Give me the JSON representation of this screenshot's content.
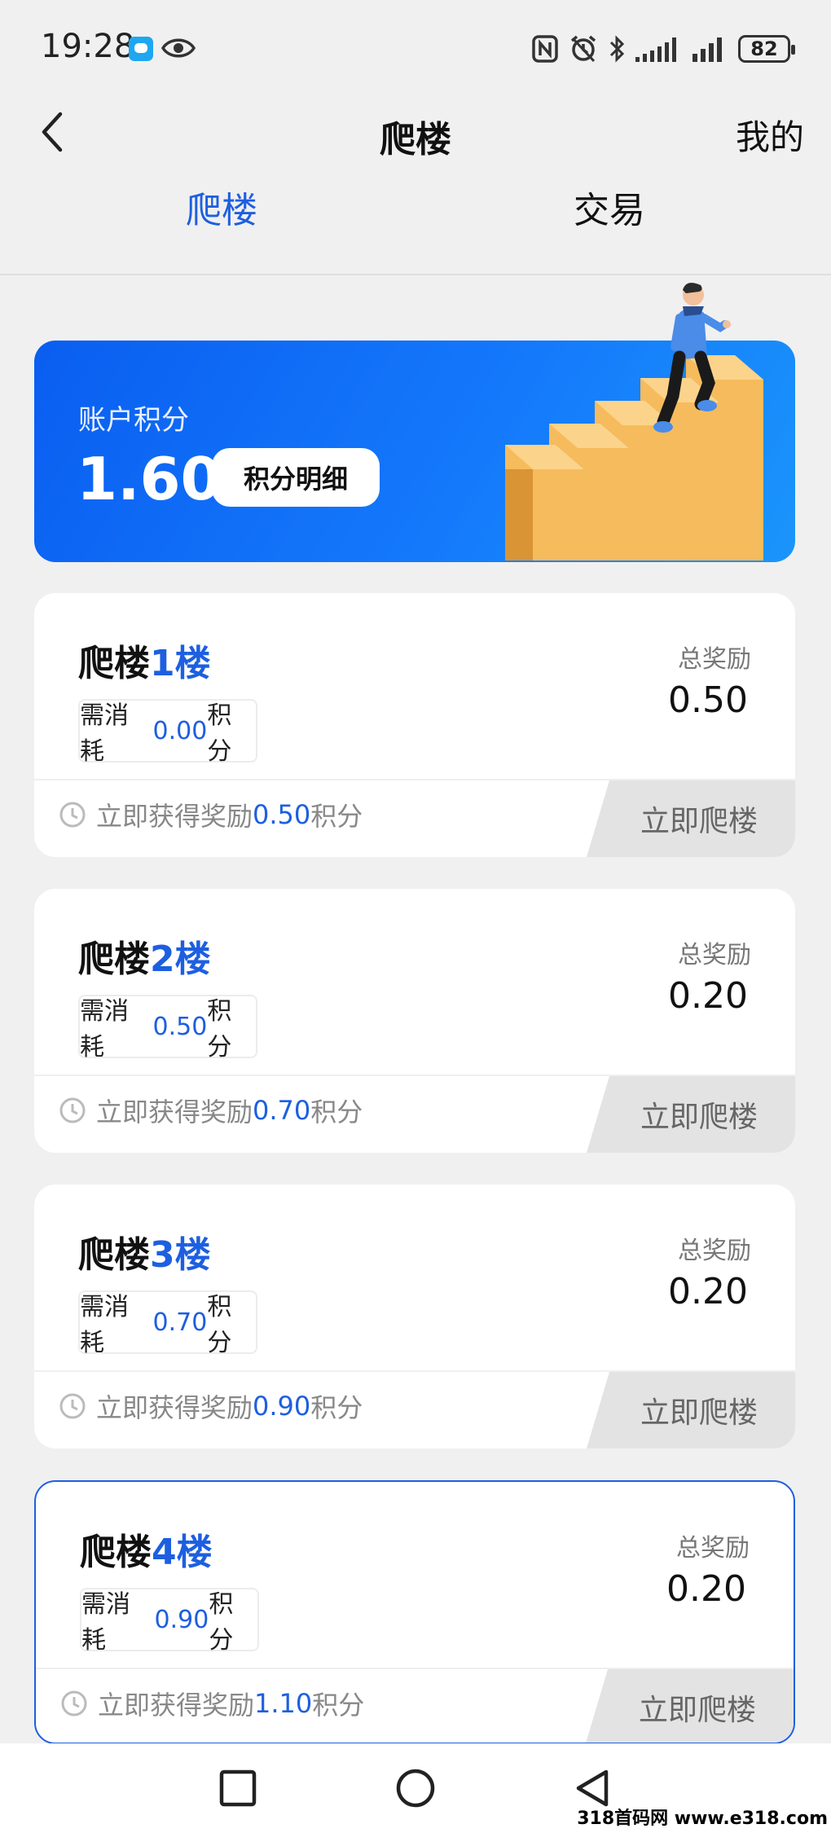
{
  "status_bar": {
    "time": "19:28",
    "battery": "82",
    "icons": [
      "message-icon",
      "eye-icon",
      "nfc-icon",
      "alarm-icon",
      "bluetooth-icon",
      "signal-icon",
      "signal-icon"
    ]
  },
  "header": {
    "title": "爬楼",
    "right_link": "我的",
    "tabs": [
      {
        "label": "爬楼",
        "active": true
      },
      {
        "label": "交易",
        "active": false
      }
    ]
  },
  "account": {
    "label": "账户积分",
    "value": "1.60",
    "detail_button": "积分明细"
  },
  "floors": [
    {
      "title_prefix": "爬楼",
      "floor_num": "1楼",
      "cost_prefix": "需消耗",
      "cost": "0.00",
      "cost_suffix": "积分",
      "reward_label": "总奖励",
      "reward": "0.50",
      "gain_prefix": "立即获得奖励",
      "gain": "0.50",
      "gain_suffix": "积分",
      "button": "立即爬楼"
    },
    {
      "title_prefix": "爬楼",
      "floor_num": "2楼",
      "cost_prefix": "需消耗",
      "cost": "0.50",
      "cost_suffix": "积分",
      "reward_label": "总奖励",
      "reward": "0.20",
      "gain_prefix": "立即获得奖励",
      "gain": "0.70",
      "gain_suffix": "积分",
      "button": "立即爬楼"
    },
    {
      "title_prefix": "爬楼",
      "floor_num": "3楼",
      "cost_prefix": "需消耗",
      "cost": "0.70",
      "cost_suffix": "积分",
      "reward_label": "总奖励",
      "reward": "0.20",
      "gain_prefix": "立即获得奖励",
      "gain": "0.90",
      "gain_suffix": "积分",
      "button": "立即爬楼"
    },
    {
      "title_prefix": "爬楼",
      "floor_num": "4楼",
      "cost_prefix": "需消耗",
      "cost": "0.90",
      "cost_suffix": "积分",
      "reward_label": "总奖励",
      "reward": "0.20",
      "gain_prefix": "立即获得奖励",
      "gain": "1.10",
      "gain_suffix": "积分",
      "button": "立即爬楼"
    }
  ],
  "watermark": "318首码网 www.e318.com",
  "colors": {
    "accent": "#1d5fe0",
    "banner_start": "#0a5ef0",
    "banner_end": "#1a95fb",
    "background": "#f0f0f0",
    "stairs": "#f6b957"
  }
}
